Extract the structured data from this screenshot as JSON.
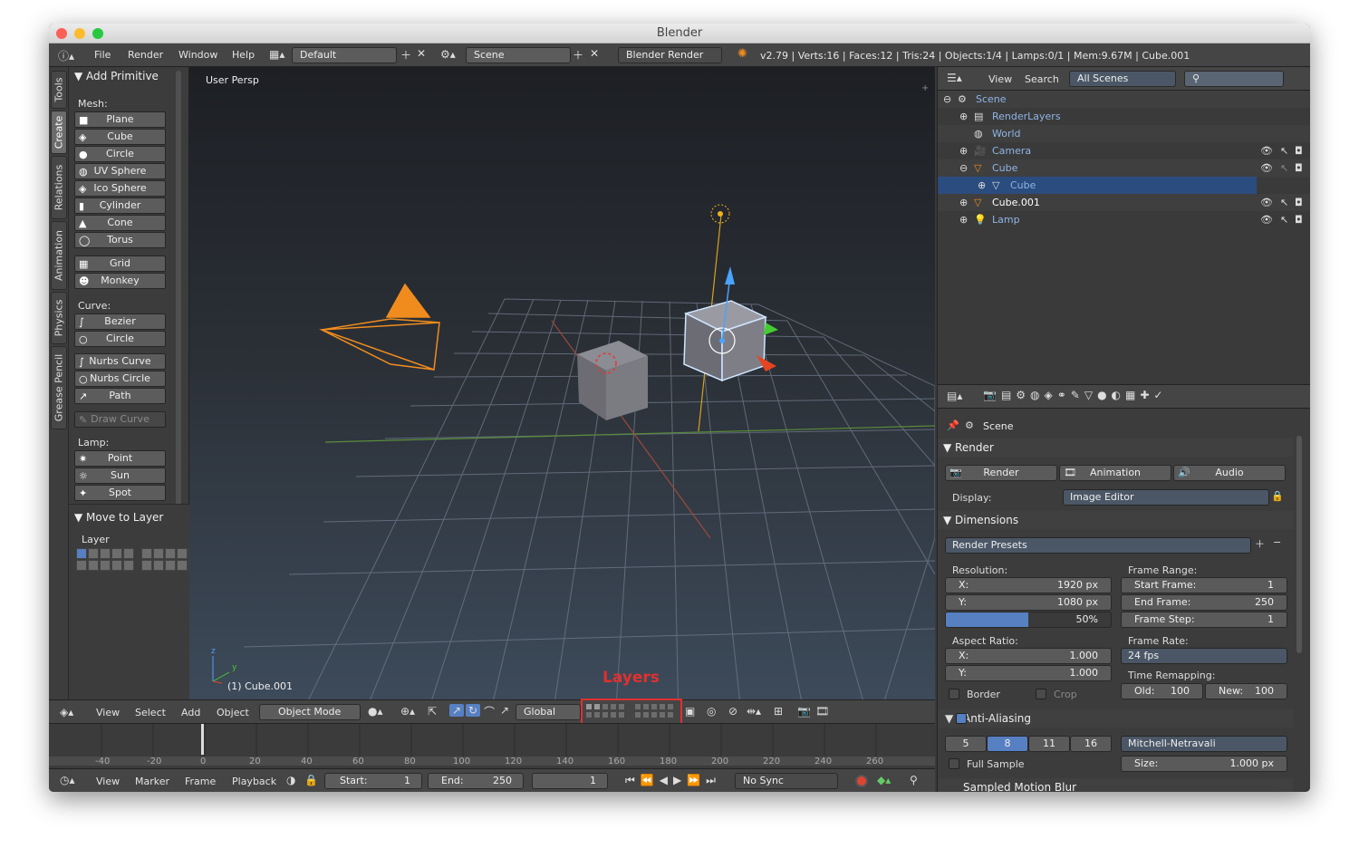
{
  "window": {
    "title": "Blender"
  },
  "info": {
    "menus": [
      "File",
      "Render",
      "Window",
      "Help"
    ],
    "layout": "Default",
    "scene": "Scene",
    "engine": "Blender Render",
    "stats": "v2.79 | Verts:16 | Faces:12 | Tris:24 | Objects:1/4 | Lamps:0/1 | Mem:9.67M | Cube.001"
  },
  "tabs": [
    "Tools",
    "Create",
    "Relations",
    "Animation",
    "Physics",
    "Grease Pencil"
  ],
  "toolshelf": {
    "panel_title": "Add Primitive",
    "mesh_label": "Mesh:",
    "mesh": [
      "Plane",
      "Cube",
      "Circle",
      "UV Sphere",
      "Ico Sphere",
      "Cylinder",
      "Cone",
      "Torus"
    ],
    "mesh2": [
      "Grid",
      "Monkey"
    ],
    "curve_label": "Curve:",
    "curve": [
      "Bezier",
      "Circle"
    ],
    "curve2": [
      "Nurbs Curve",
      "Nurbs Circle",
      "Path"
    ],
    "draw_curve": "Draw Curve",
    "lamp_label": "Lamp:",
    "lamp": [
      "Point",
      "Sun",
      "Spot"
    ],
    "move_panel": "Move to Layer",
    "layer_label": "Layer"
  },
  "viewport": {
    "label": "User Persp",
    "object_info": "(1) Cube.001",
    "annotation": "Layers",
    "axis_z": "z",
    "axis_y": "y"
  },
  "vp_header": {
    "menus": [
      "View",
      "Select",
      "Add",
      "Object"
    ],
    "mode": "Object Mode",
    "orientation": "Global"
  },
  "timeline": {
    "ticks": [
      "-40",
      "-20",
      "0",
      "20",
      "40",
      "60",
      "80",
      "100",
      "120",
      "140",
      "160",
      "180",
      "200",
      "220",
      "240",
      "260"
    ]
  },
  "tl_header": {
    "menus": [
      "View",
      "Marker",
      "Frame",
      "Playback"
    ],
    "start": "Start:",
    "start_val": "1",
    "end": "End:",
    "end_val": "250",
    "current": "1",
    "sync": "No Sync"
  },
  "outliner": {
    "menus": [
      "View",
      "Search"
    ],
    "filter": "All Scenes",
    "rows": [
      {
        "name": "Scene"
      },
      {
        "name": "RenderLayers"
      },
      {
        "name": "World"
      },
      {
        "name": "Camera"
      },
      {
        "name": "Cube"
      },
      {
        "name": "Cube"
      },
      {
        "name": "Cube.001"
      },
      {
        "name": "Lamp"
      }
    ]
  },
  "props": {
    "context": "Scene",
    "render_panel": "Render",
    "render_btn": "Render",
    "animation_btn": "Animation",
    "audio_btn": "Audio",
    "display_label": "Display:",
    "display_val": "Image Editor",
    "dim_panel": "Dimensions",
    "presets": "Render Presets",
    "resolution": "Resolution:",
    "res_x_l": "X:",
    "res_x": "1920 px",
    "res_y_l": "Y:",
    "res_y": "1080 px",
    "res_pct": "50%",
    "res_fraction": 0.5,
    "frame_range": "Frame Range:",
    "start_frame_l": "Start Frame:",
    "start_frame": "1",
    "end_frame_l": "End Frame:",
    "end_frame": "250",
    "frame_step_l": "Frame Step:",
    "frame_step": "1",
    "aspect": "Aspect Ratio:",
    "asp_x_l": "X:",
    "asp_x": "1.000",
    "asp_y_l": "Y:",
    "asp_y": "1.000",
    "frame_rate": "Frame Rate:",
    "fps": "24 fps",
    "time_remap": "Time Remapping:",
    "old_l": "Old:",
    "old": "100",
    "new_l": "New:",
    "new": "100",
    "border": "Border",
    "crop": "Crop",
    "aa_panel": "Anti-Aliasing",
    "aa_samples": [
      "5",
      "8",
      "11",
      "16"
    ],
    "aa_filter": "Mitchell-Netravali",
    "full_sample": "Full Sample",
    "size_l": "Size:",
    "size": "1.000 px",
    "smb": "Sampled Motion Blur"
  },
  "colors": {
    "accent": "#5680c2",
    "selected": "#2a4c7e",
    "annotation": "#e03030",
    "camera": "#f08c1e"
  }
}
